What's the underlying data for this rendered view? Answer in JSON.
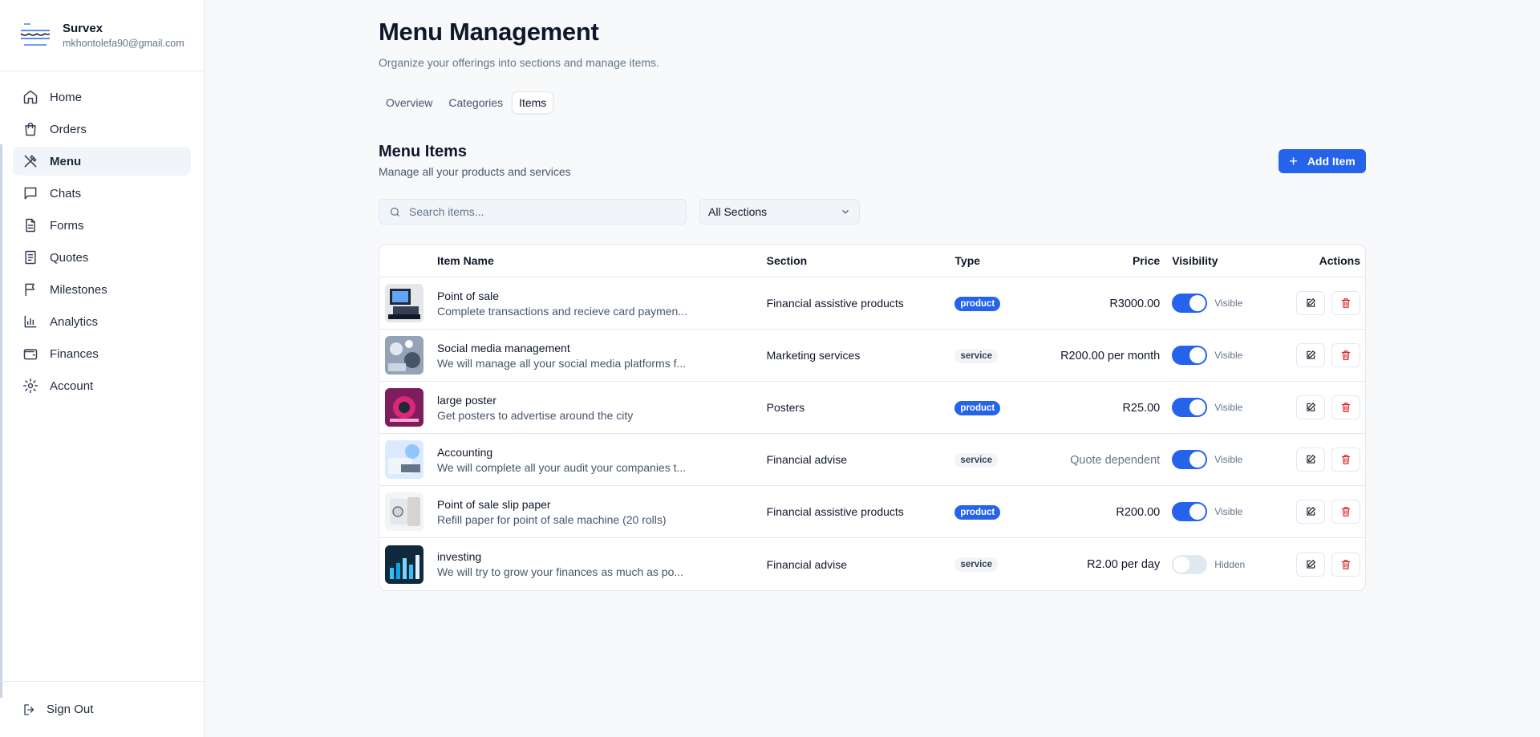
{
  "sidebar": {
    "brand": {
      "name": "Survex",
      "email": "mkhontolefa90@gmail.com"
    },
    "items": [
      {
        "label": "Home",
        "icon": "home-icon"
      },
      {
        "label": "Orders",
        "icon": "shopping-bag-icon"
      },
      {
        "label": "Menu",
        "icon": "utensils-icon",
        "active": true
      },
      {
        "label": "Chats",
        "icon": "chat-icon"
      },
      {
        "label": "Forms",
        "icon": "file-text-icon"
      },
      {
        "label": "Quotes",
        "icon": "receipt-icon"
      },
      {
        "label": "Milestones",
        "icon": "flag-icon"
      },
      {
        "label": "Analytics",
        "icon": "bar-chart-icon"
      },
      {
        "label": "Finances",
        "icon": "wallet-icon"
      },
      {
        "label": "Account",
        "icon": "gear-icon"
      }
    ],
    "sign_out": "Sign Out"
  },
  "header": {
    "title": "Menu Management",
    "subtitle": "Organize your offerings into sections and manage items."
  },
  "tabs": [
    {
      "label": "Overview"
    },
    {
      "label": "Categories"
    },
    {
      "label": "Items",
      "active": true
    }
  ],
  "section": {
    "title": "Menu Items",
    "subtitle": "Manage all your products and services",
    "add_label": "Add Item"
  },
  "filters": {
    "search_placeholder": "Search items...",
    "section_select": "All Sections"
  },
  "table": {
    "columns": [
      "Item Name",
      "Section",
      "Type",
      "Price",
      "Visibility",
      "Actions"
    ],
    "rows": [
      {
        "name": "Point of sale",
        "desc": "Complete transactions and recieve card paymen...",
        "section": "Financial assistive products",
        "type": "product",
        "price": "R3000.00",
        "visibility": "Visible"
      },
      {
        "name": "Social media management",
        "desc": "We will manage all your social media platforms f...",
        "section": "Marketing services",
        "type": "service",
        "price": "R200.00 per month",
        "visibility": "Visible"
      },
      {
        "name": "large poster",
        "desc": "Get posters to advertise around the city",
        "section": "Posters",
        "type": "product",
        "price": "R25.00",
        "visibility": "Visible"
      },
      {
        "name": "Accounting",
        "desc": "We will complete all your audit your companies t...",
        "section": "Financial advise",
        "type": "service",
        "price": "Quote dependent",
        "visibility": "Visible"
      },
      {
        "name": "Point of sale slip paper",
        "desc": "Refill paper for point of sale machine (20 rolls)",
        "section": "Financial assistive products",
        "type": "product",
        "price": "R200.00",
        "visibility": "Visible"
      },
      {
        "name": "investing",
        "desc": "We will try to grow your finances as much as po...",
        "section": "Financial advise",
        "type": "service",
        "price": "R2.00 per day",
        "visibility": "Hidden"
      }
    ]
  },
  "colors": {
    "accent": "#2563eb",
    "danger": "#dc2626",
    "muted": "#64748b"
  }
}
